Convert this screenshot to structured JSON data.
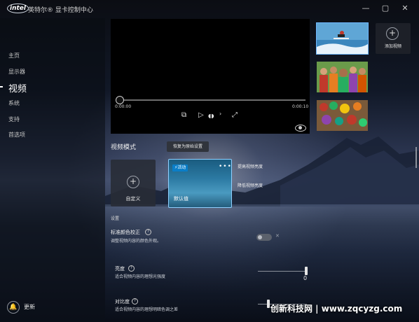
{
  "window": {
    "logo_text": "intel",
    "title": "英特尔® 显卡控制中心",
    "controls": [
      "—",
      "▢",
      "✕"
    ]
  },
  "sidebar": {
    "items": [
      {
        "label": "主页"
      },
      {
        "label": "显示器"
      },
      {
        "label": "视频",
        "active": true
      },
      {
        "label": "系统"
      },
      {
        "label": "支持"
      },
      {
        "label": "首选项"
      }
    ],
    "update_label": "更新"
  },
  "player": {
    "current_time": "0:00:00",
    "total_time": "0:00:10",
    "progress": 0,
    "icons": [
      "frame-icon",
      "play-icon",
      "audio-icon",
      "next-icon",
      "expand-icon",
      "eye-icon"
    ]
  },
  "thumbnails": [
    {
      "name": "surfer",
      "selected": true
    },
    {
      "name": "group-photo",
      "selected": false
    },
    {
      "name": "food-market",
      "selected": false
    }
  ],
  "add_video": {
    "label": "添加视频"
  },
  "video_mode": {
    "heading": "视频模式",
    "restore_label": "恢复为原始设置",
    "custom_label": "自定义",
    "default_label": "默认值",
    "active_badge": "⚡活动",
    "more": "•••",
    "options": [
      "提高视频亮度",
      "降低视频亮度"
    ]
  },
  "settings": {
    "heading": "设置",
    "color_correction": {
      "title": "标准颜色校正",
      "description": "调整视频内容的颜色外观。",
      "toggle_state": "off",
      "toggle_mark": "✕"
    },
    "brightness": {
      "title": "亮度",
      "description": "适合视频内容的理想光强度",
      "value": "0"
    },
    "contrast": {
      "title": "对比度",
      "description": "适合视频内容的理想明暗色调之差"
    }
  },
  "watermark": "创新科技网 | www.zqcyzg.com",
  "colors": {
    "accent": "#0a7ec8",
    "selection": "#8fd0ff"
  }
}
